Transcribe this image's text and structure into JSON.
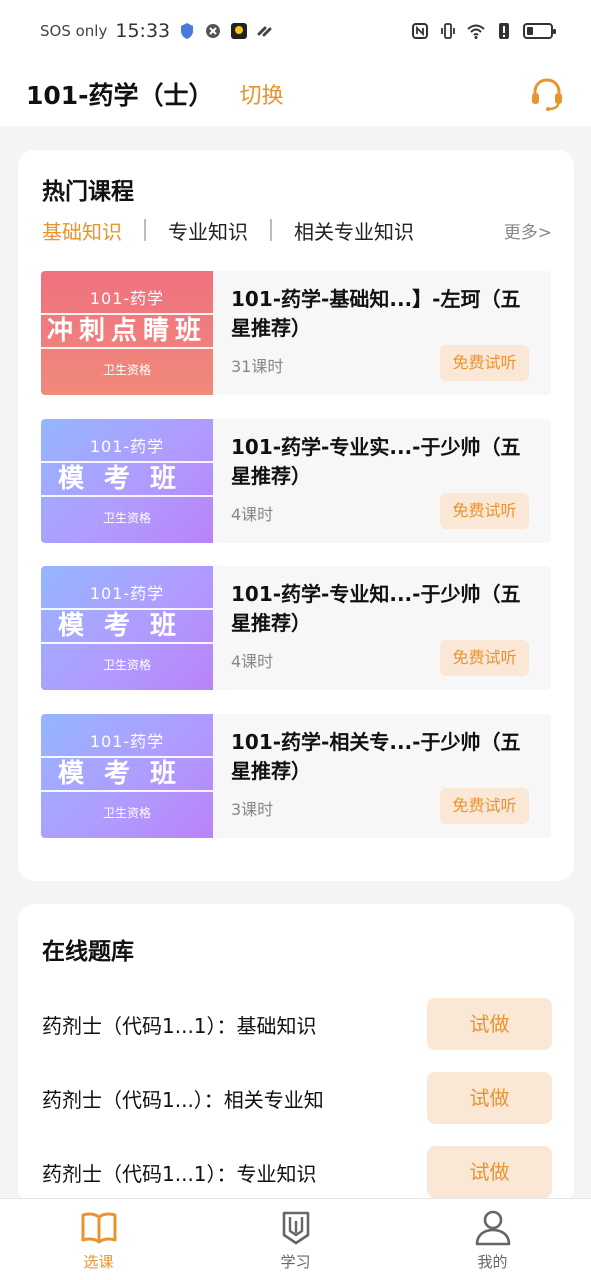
{
  "status_bar": {
    "carrier": "SOS only",
    "time": "15:33"
  },
  "header": {
    "title": "101-药学（士）",
    "switch_label": "切换",
    "support_icon": "headset-icon"
  },
  "hot_courses": {
    "title": "热门课程",
    "tabs": [
      "基础知识",
      "专业知识",
      "相关专业知识"
    ],
    "active_tab": "基础知识",
    "more_label": "更多>",
    "items": [
      {
        "thumb_top": "101-药学",
        "thumb_band": "冲刺点睛班",
        "thumb_bottom": "卫生资格",
        "title": "101-药学-基础知...】-左珂（五星推荐）",
        "hours": "31课时",
        "trial": "免费试听"
      },
      {
        "thumb_top": "101-药学",
        "thumb_band": "模考班",
        "thumb_bottom": "卫生资格",
        "title": "101-药学-专业实...-于少帅（五星推荐）",
        "hours": "4课时",
        "trial": "免费试听"
      },
      {
        "thumb_top": "101-药学",
        "thumb_band": "模考班",
        "thumb_bottom": "卫生资格",
        "title": "101-药学-专业知...-于少帅（五星推荐）",
        "hours": "4课时",
        "trial": "免费试听"
      },
      {
        "thumb_top": "101-药学",
        "thumb_band": "模考班",
        "thumb_bottom": "卫生资格",
        "title": "101-药学-相关专...-于少帅（五星推荐）",
        "hours": "3课时",
        "trial": "免费试听"
      }
    ]
  },
  "question_bank": {
    "title": "在线题库",
    "items": [
      {
        "label": "药剂士（代码1...1）：基础知识",
        "button": "试做"
      },
      {
        "label": "药剂士（代码1...）：相关专业知",
        "button": "试做"
      },
      {
        "label": "药剂士（代码1...1）：专业知识",
        "button": "试做"
      }
    ]
  },
  "tabbar": {
    "items": [
      {
        "label": "选课",
        "icon": "book-icon",
        "active": true
      },
      {
        "label": "学习",
        "icon": "pencil-icon",
        "active": false
      },
      {
        "label": "我的",
        "icon": "user-icon",
        "active": false
      }
    ]
  },
  "colors": {
    "accent": "#e8942f",
    "accent_bg": "#fbe7d6",
    "thumb_red": "#ef7180",
    "thumb_purple": "#b09cff"
  }
}
